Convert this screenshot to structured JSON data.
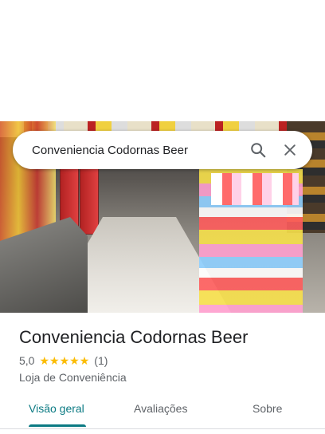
{
  "search": {
    "query": "Conveniencia Codornas Beer"
  },
  "place": {
    "name": "Conveniencia Codornas Beer",
    "rating": "5,0",
    "review_count": "(1)",
    "stars": 5,
    "category": "Loja de Conveniência"
  },
  "tabs": [
    {
      "label": "Visão geral",
      "active": true
    },
    {
      "label": "Avaliações",
      "active": false
    },
    {
      "label": "Sobre",
      "active": false
    }
  ],
  "colors": {
    "accent": "#0b7a83",
    "star": "#fbbc04",
    "text": "#202124",
    "secondary": "#5f6368"
  },
  "icons": {
    "search": "search-icon",
    "close": "close-icon",
    "star": "star-icon"
  }
}
